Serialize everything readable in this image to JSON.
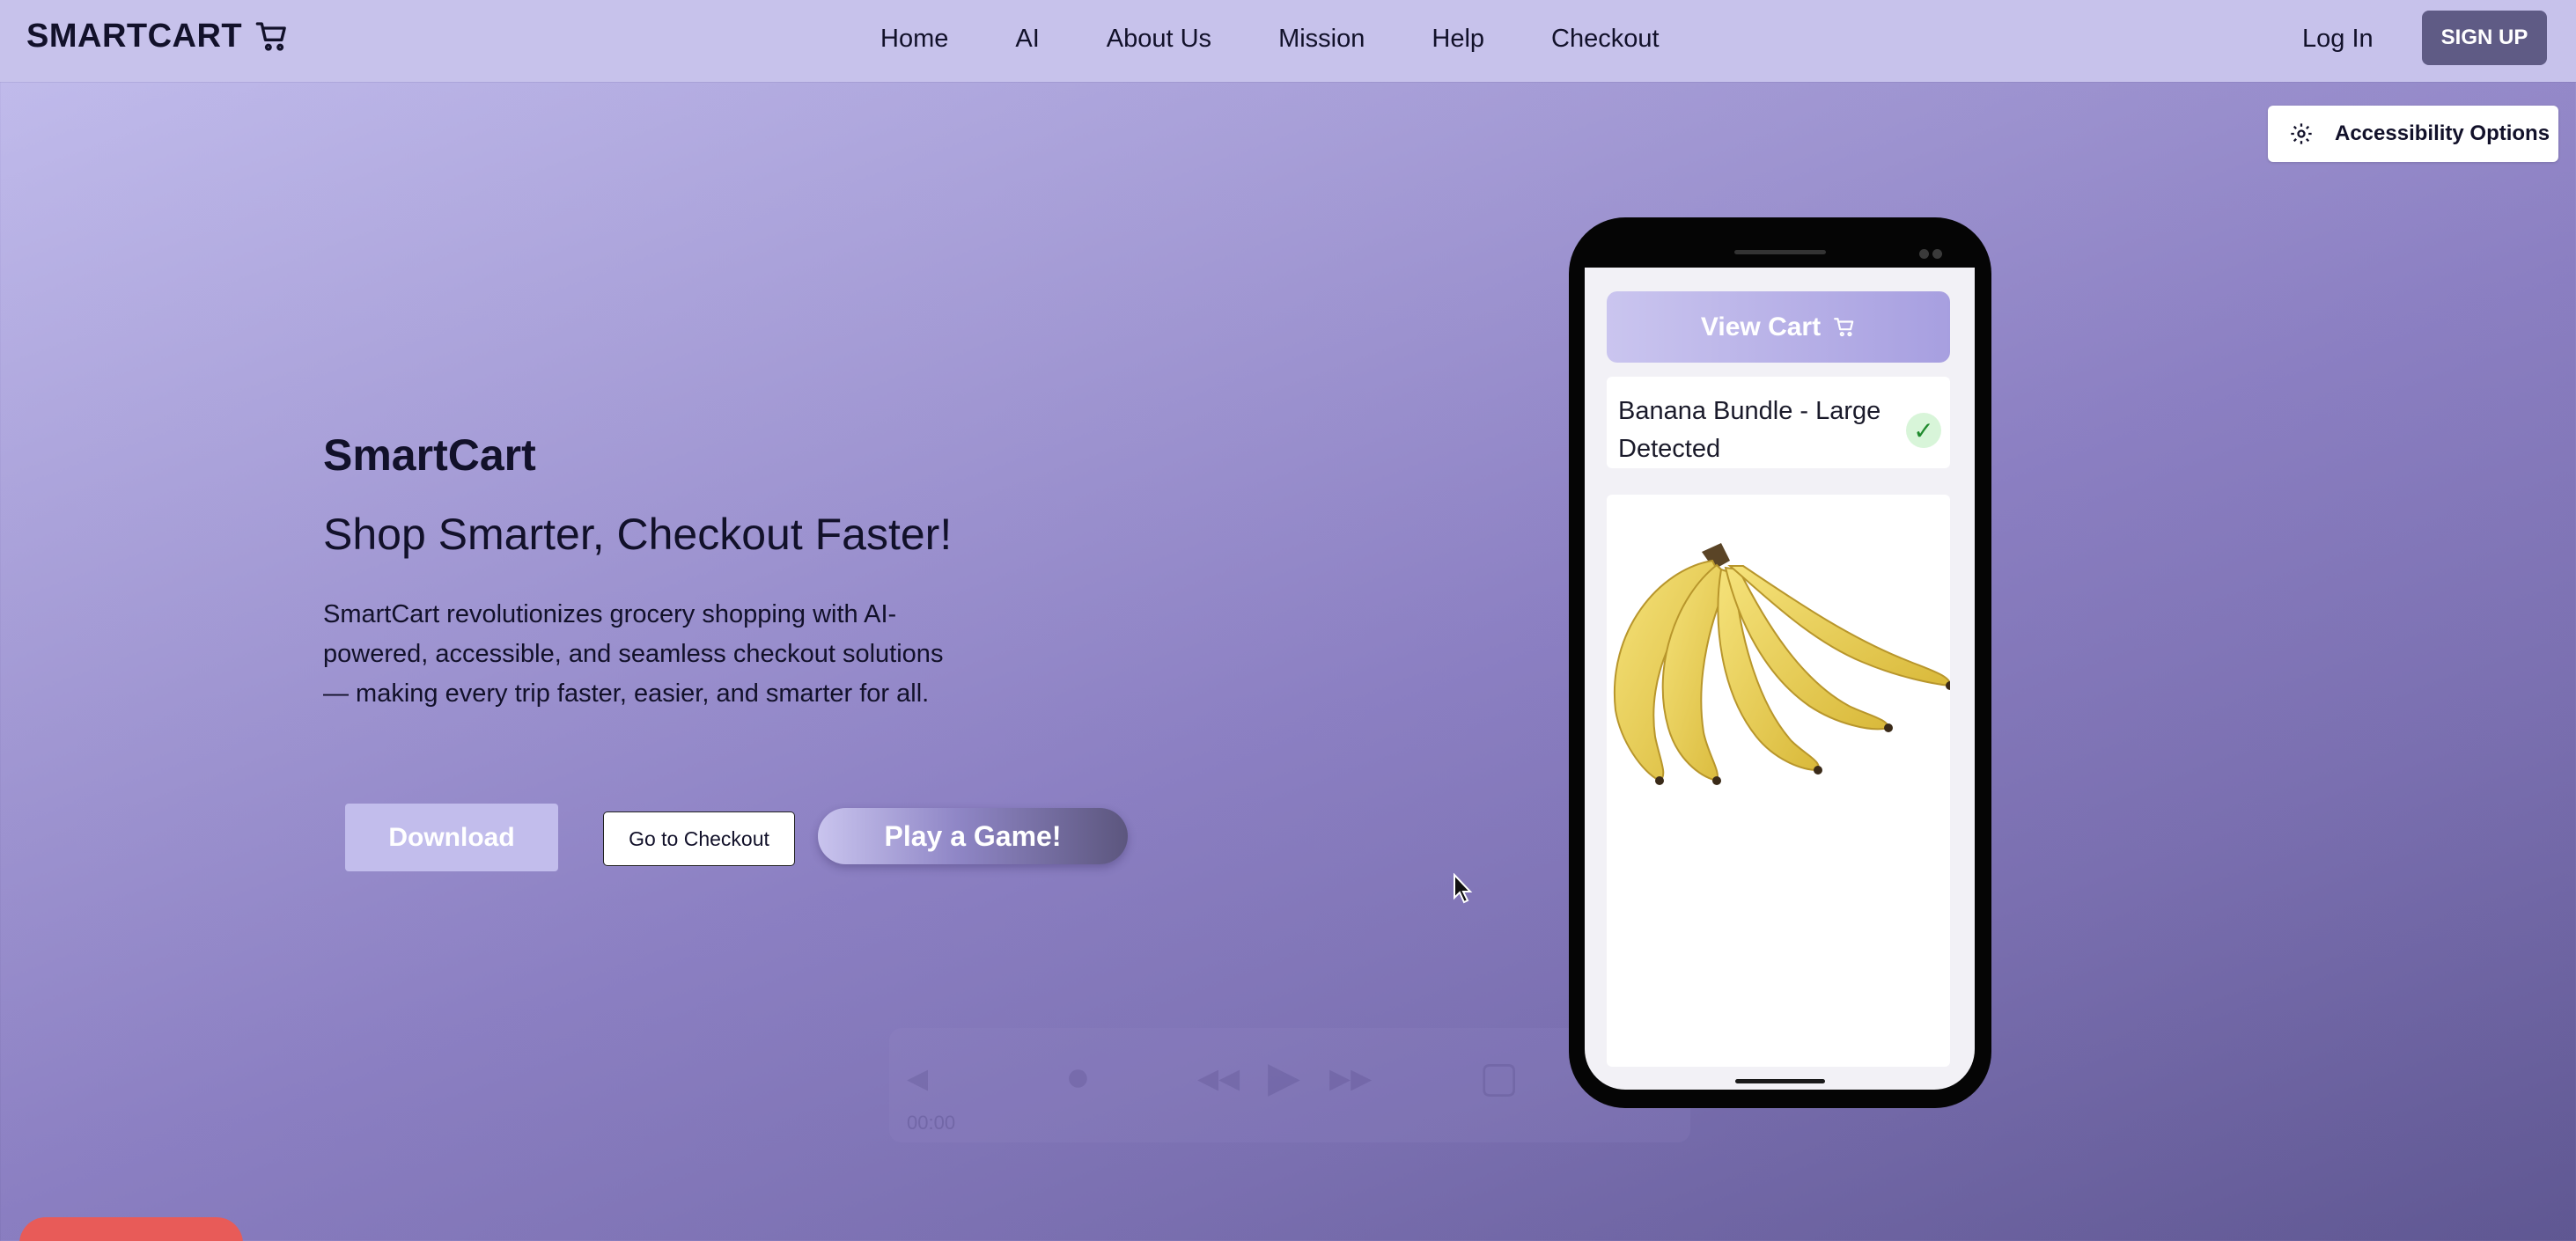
{
  "header": {
    "brand": "SMARTCART",
    "nav": [
      "Home",
      "AI",
      "About Us",
      "Mission",
      "Help",
      "Checkout"
    ],
    "login_label": "Log In",
    "signup_label": "SIGN UP"
  },
  "accessibility": {
    "label": "Accessibility Options",
    "icon": "gear-icon"
  },
  "hero": {
    "title": "SmartCart",
    "subtitle": "Shop Smarter, Checkout Faster!",
    "description": "SmartCart revolutionizes grocery shopping with AI-powered, accessible, and seamless checkout solutions — making every trip faster, easier, and smarter for all.",
    "download_label": "Download",
    "checkout_label": "Go to Checkout",
    "game_label": "Play a Game!"
  },
  "phone": {
    "view_cart_label": "View Cart",
    "detection_text": "Banana Bundle - Large Detected",
    "detection_status": "✓",
    "product_image": "banana-bundle"
  },
  "video_controls": {
    "current_time": "00:00",
    "icons": [
      "volume-icon",
      "record-icon",
      "rewind-icon",
      "play-icon",
      "fast-forward-icon",
      "pip-icon",
      "fullscreen-icon"
    ]
  },
  "colors": {
    "header_bg": "#c7c2eb",
    "signup_bg": "#5f5b85",
    "download_bg": "#c2bdec",
    "check_bg": "#d8f5d9",
    "check_color": "#1f8a2d",
    "bottom_pill": "#e85b58"
  }
}
